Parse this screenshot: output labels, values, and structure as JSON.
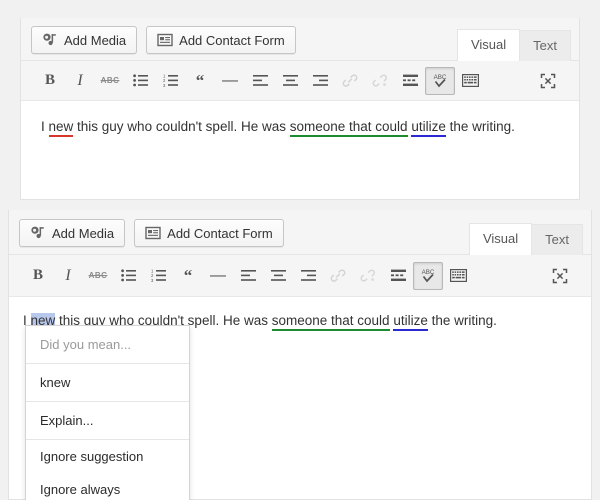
{
  "page": {
    "background": "#f1f1f1"
  },
  "colors": {
    "error_red": "#d7372b",
    "grammar_green": "#1d8b2f",
    "style_blue": "#2a2ad0",
    "selection": "#b8c8ec",
    "toolbar_bg": "#f5f5f5"
  },
  "editor_top": {
    "media_buttons": [
      {
        "label": "Add Media",
        "icon": "add-media-icon"
      },
      {
        "label": "Add Contact Form",
        "icon": "contact-form-icon"
      }
    ],
    "tabs": [
      {
        "label": "Visual",
        "active": true
      },
      {
        "label": "Text",
        "active": false
      }
    ],
    "toolbar": [
      {
        "name": "bold",
        "glyph": "B"
      },
      {
        "name": "italic",
        "glyph": "I"
      },
      {
        "name": "strikethrough",
        "glyph": "ABC"
      },
      {
        "name": "unordered-list",
        "glyph": ""
      },
      {
        "name": "ordered-list",
        "glyph": ""
      },
      {
        "name": "blockquote",
        "glyph": "“"
      },
      {
        "name": "horizontal-rule",
        "glyph": "—"
      },
      {
        "name": "align-left",
        "glyph": ""
      },
      {
        "name": "align-center",
        "glyph": ""
      },
      {
        "name": "align-right",
        "glyph": ""
      },
      {
        "name": "insert-link",
        "glyph": ""
      },
      {
        "name": "unlink",
        "glyph": ""
      },
      {
        "name": "insert-read-more",
        "glyph": ""
      },
      {
        "name": "spellcheck",
        "glyph": "ABC",
        "pressed": true
      },
      {
        "name": "keyboard-shortcuts",
        "glyph": ""
      },
      {
        "name": "fullscreen",
        "glyph": ""
      }
    ],
    "document": {
      "segments": [
        {
          "text": "I ",
          "mark": "none"
        },
        {
          "text": "new",
          "mark": "red"
        },
        {
          "text": " this guy who couldn't spell. He was ",
          "mark": "none"
        },
        {
          "text": "someone that could",
          "mark": "green"
        },
        {
          "text": " ",
          "mark": "none"
        },
        {
          "text": "utilize",
          "mark": "blue"
        },
        {
          "text": " the writing.",
          "mark": "none"
        }
      ]
    }
  },
  "editor_bottom": {
    "media_buttons": [
      {
        "label": "Add Media",
        "icon": "add-media-icon"
      },
      {
        "label": "Add Contact Form",
        "icon": "contact-form-icon"
      }
    ],
    "tabs": [
      {
        "label": "Visual",
        "active": true
      },
      {
        "label": "Text",
        "active": false
      }
    ],
    "document": {
      "segments": [
        {
          "text": "I ",
          "mark": "none"
        },
        {
          "text": "new",
          "mark": "red-selected"
        },
        {
          "text": " this guy who couldn't spell. He was ",
          "mark": "none"
        },
        {
          "text": "someone that could",
          "mark": "green"
        },
        {
          "text": " ",
          "mark": "none"
        },
        {
          "text": "utilize",
          "mark": "blue"
        },
        {
          "text": " the writing.",
          "mark": "none"
        }
      ]
    },
    "suggestion_menu": {
      "header": "Did you mean...",
      "items": [
        {
          "label": "knew"
        },
        {
          "label": "Explain..."
        },
        {
          "label": "Ignore suggestion"
        },
        {
          "label": "Ignore always"
        }
      ]
    }
  }
}
